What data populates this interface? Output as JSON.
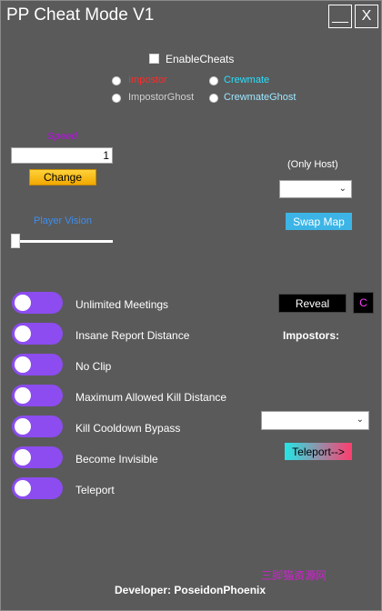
{
  "window": {
    "title": "PP Cheat Mode V1",
    "minimize_label": "__",
    "close_label": "X"
  },
  "cheats": {
    "enable_label": "EnableCheats",
    "roles": [
      {
        "label": "Impostor",
        "color": "#ff2a2a"
      },
      {
        "label": "Crewmate",
        "color": "#28e0ff"
      },
      {
        "label": "ImpostorGhost",
        "color": "#cfcfcf"
      },
      {
        "label": "CrewmateGhost",
        "color": "#9ee6ff"
      }
    ]
  },
  "speed": {
    "label": "Speed",
    "value": "1",
    "change_label": "Change"
  },
  "vision": {
    "label": "Player Vision"
  },
  "host": {
    "label": "(Only Host)",
    "swap_label": "Swap Map"
  },
  "toggles": [
    {
      "label": "Unlimited Meetings"
    },
    {
      "label": "Insane Report Distance"
    },
    {
      "label": "No Clip"
    },
    {
      "label": "Maximum Allowed Kill Distance"
    },
    {
      "label": "Kill Cooldown Bypass"
    },
    {
      "label": "Become Invisible"
    },
    {
      "label": "Teleport"
    }
  ],
  "reveal": {
    "label": "Reveal",
    "c_label": "C"
  },
  "impostors": {
    "label": "Impostors:"
  },
  "teleport": {
    "label": "Teleport-->"
  },
  "footer": {
    "developer": "Developer: PoseidonPhoenix",
    "watermark": "三脚猫资源网"
  }
}
